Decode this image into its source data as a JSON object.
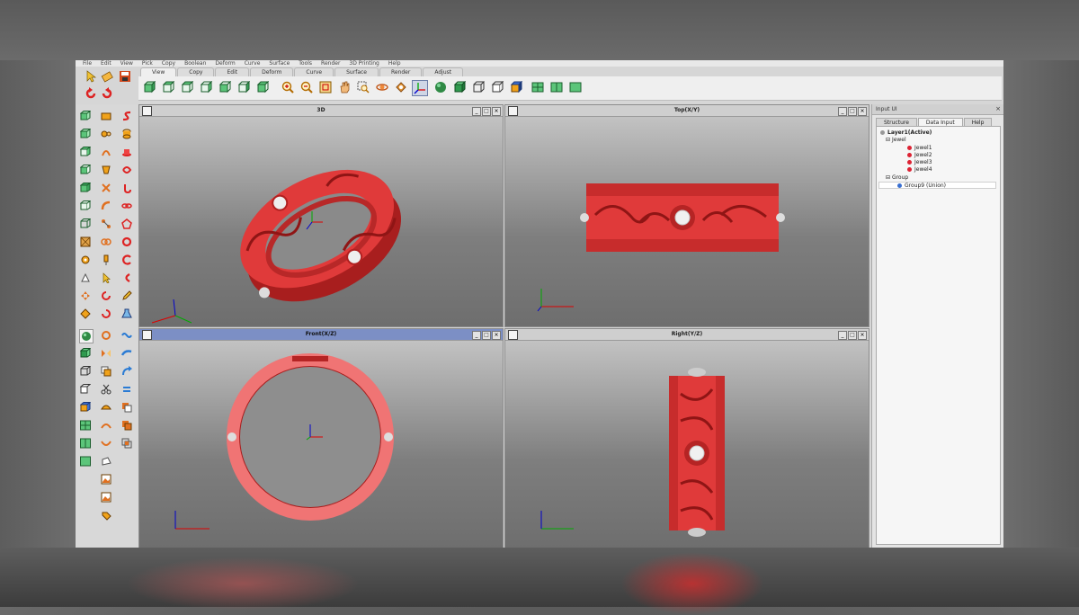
{
  "menu": [
    "File",
    "Edit",
    "View",
    "Pick",
    "Copy",
    "Boolean",
    "Deform",
    "Curve",
    "Surface",
    "Tools",
    "Render",
    "3D Printing",
    "Help"
  ],
  "ribbon_tabs": [
    "View",
    "Copy",
    "Edit",
    "Deform",
    "Curve",
    "Surface",
    "Render",
    "Adjust"
  ],
  "active_ribbon_tab": "View",
  "viewports": {
    "v3d": {
      "title": "3D"
    },
    "top": {
      "title": "Top(X/Y)"
    },
    "front": {
      "title": "Front(X/Z)"
    },
    "right": {
      "title": "Right(Y/Z)"
    },
    "controls": {
      "minimize": "_",
      "restore": "□",
      "close": "×"
    }
  },
  "panel": {
    "title": "Input UI",
    "close": "×",
    "tabs": [
      "Structure",
      "Data Input",
      "Help"
    ],
    "tree": {
      "layer": "Layer1(Active)",
      "jewel_group": "Jewel",
      "jewels": [
        "Jewel1",
        "Jewel2",
        "Jewel3",
        "Jewel4"
      ],
      "group": "Group",
      "group_item": "Group9 (Union)"
    }
  },
  "colors": {
    "ring": "#e03a3a",
    "ring_dark": "#a81e1e",
    "ring_front": "#f07474",
    "gem": "#eeeeee",
    "viewport_active": "#7c8fc5"
  }
}
